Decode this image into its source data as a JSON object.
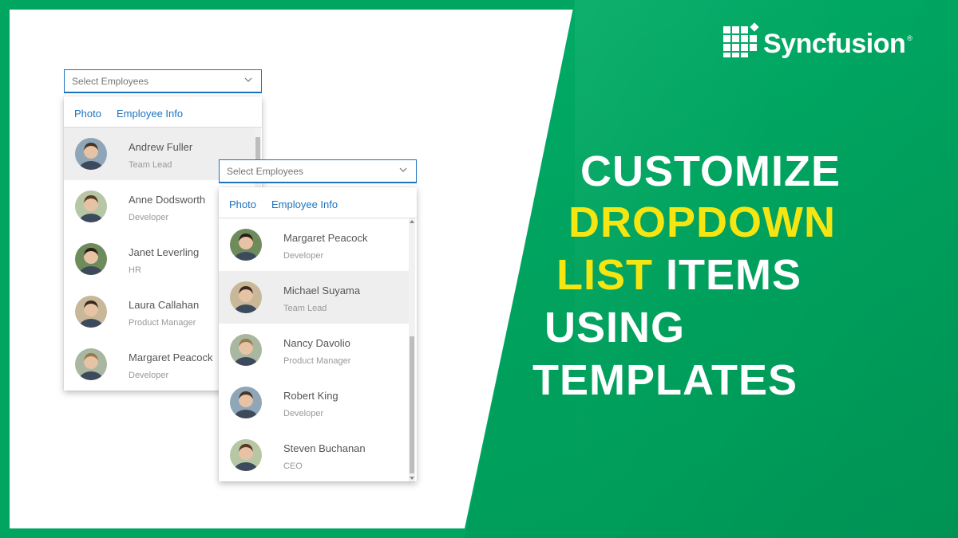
{
  "brand": {
    "name": "Syncfusion",
    "registered": "®"
  },
  "headline": {
    "line1": "CUSTOMIZE",
    "line2": "DROPDOWN",
    "line3_highlight": "LIST",
    "line3_rest": "ITEMS",
    "line4": "USING",
    "line5": "TEMPLATES"
  },
  "colors": {
    "green": "#00a560",
    "yellow": "#f5e612",
    "accent_blue": "#1e73be",
    "highlight": "#eeeeee"
  },
  "dropdown1": {
    "placeholder": "Select Employees",
    "header": {
      "col1": "Photo",
      "col2": "Employee Info"
    },
    "items": [
      {
        "name": "Andrew Fuller",
        "role": "Team Lead",
        "avatar": "avatar-icon",
        "highlighted": true
      },
      {
        "name": "Anne Dodsworth",
        "role": "Developer",
        "avatar": "avatar-icon",
        "highlighted": false
      },
      {
        "name": "Janet Leverling",
        "role": "HR",
        "avatar": "avatar-icon",
        "highlighted": false
      },
      {
        "name": "Laura Callahan",
        "role": "Product Manager",
        "avatar": "avatar-icon",
        "highlighted": false
      },
      {
        "name": "Margaret Peacock",
        "role": "Developer",
        "avatar": "avatar-icon",
        "highlighted": false
      }
    ]
  },
  "dropdown2": {
    "placeholder": "Select Employees",
    "header": {
      "col1": "Photo",
      "col2": "Employee Info"
    },
    "items": [
      {
        "name": "Margaret Peacock",
        "role": "Developer",
        "avatar": "avatar-icon",
        "highlighted": false
      },
      {
        "name": "Michael Suyama",
        "role": "Team Lead",
        "avatar": "avatar-icon",
        "highlighted": true
      },
      {
        "name": "Nancy Davolio",
        "role": "Product Manager",
        "avatar": "avatar-icon",
        "highlighted": false
      },
      {
        "name": "Robert King",
        "role": "Developer",
        "avatar": "avatar-icon",
        "highlighted": false
      },
      {
        "name": "Steven Buchanan",
        "role": "CEO",
        "avatar": "avatar-icon",
        "highlighted": false
      }
    ]
  }
}
